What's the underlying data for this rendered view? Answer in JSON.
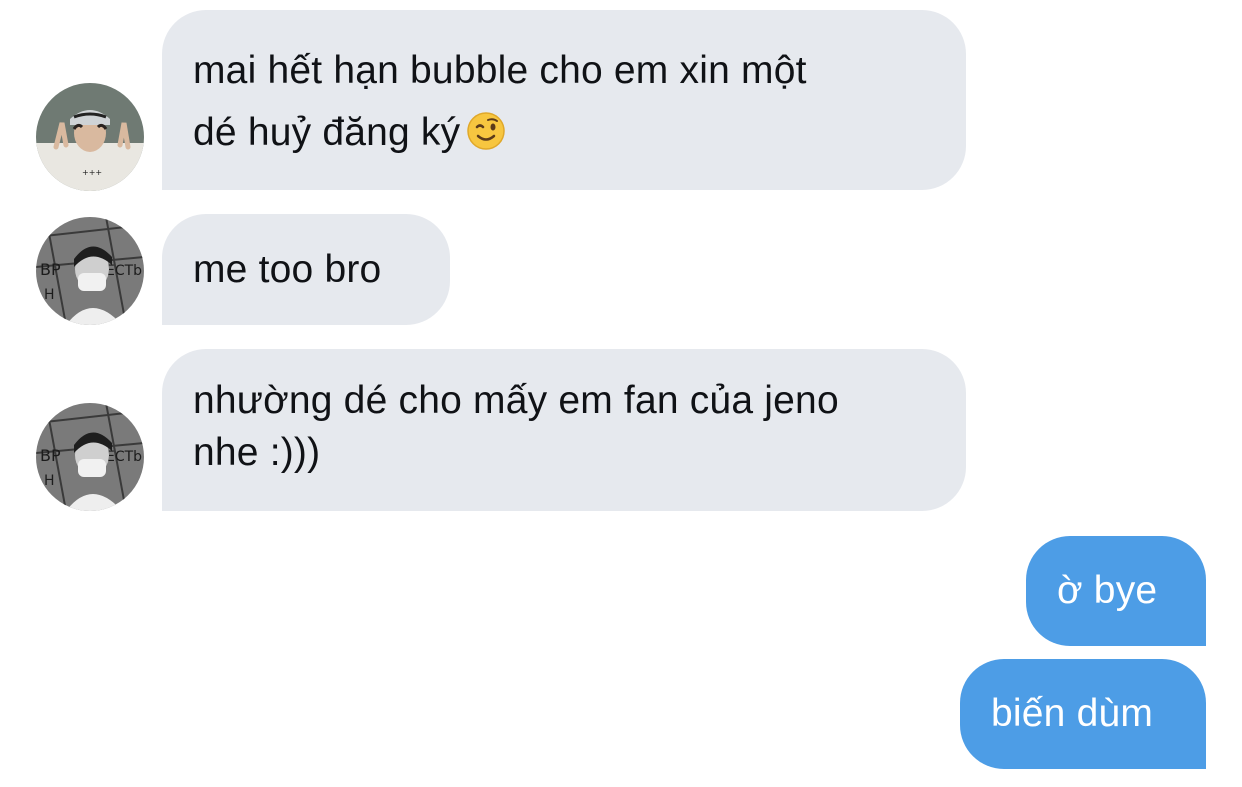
{
  "messages": [
    {
      "direction": "incoming",
      "avatar": "avatar-user-cap",
      "lines": [
        "mai hết hạn bubble cho em xin một",
        "dé huỷ đăng ký"
      ],
      "emoji": "winking-face-emoji"
    },
    {
      "direction": "incoming",
      "avatar": "avatar-user-mask",
      "lines": [
        "me too bro"
      ]
    },
    {
      "direction": "incoming",
      "avatar": "avatar-user-mask",
      "lines": [
        "nhường dé cho mấy em fan của jeno",
        "nhe :)))"
      ]
    },
    {
      "direction": "outgoing",
      "lines": [
        "ờ bye"
      ]
    },
    {
      "direction": "outgoing",
      "lines": [
        "biến dùm"
      ]
    }
  ],
  "colors": {
    "incoming_bubble": "#e6e9ee",
    "outgoing_bubble": "#4d9de6",
    "background": "#ffffff"
  }
}
